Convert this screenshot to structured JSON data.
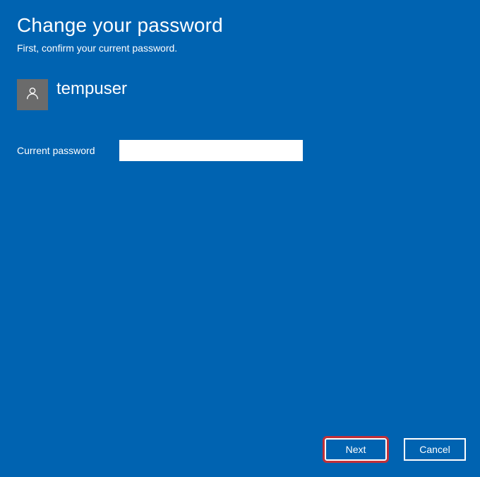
{
  "header": {
    "title": "Change your password",
    "subtitle": "First, confirm your current password."
  },
  "user": {
    "name": "tempuser"
  },
  "form": {
    "current_password_label": "Current password",
    "current_password_value": ""
  },
  "buttons": {
    "next": "Next",
    "cancel": "Cancel"
  }
}
